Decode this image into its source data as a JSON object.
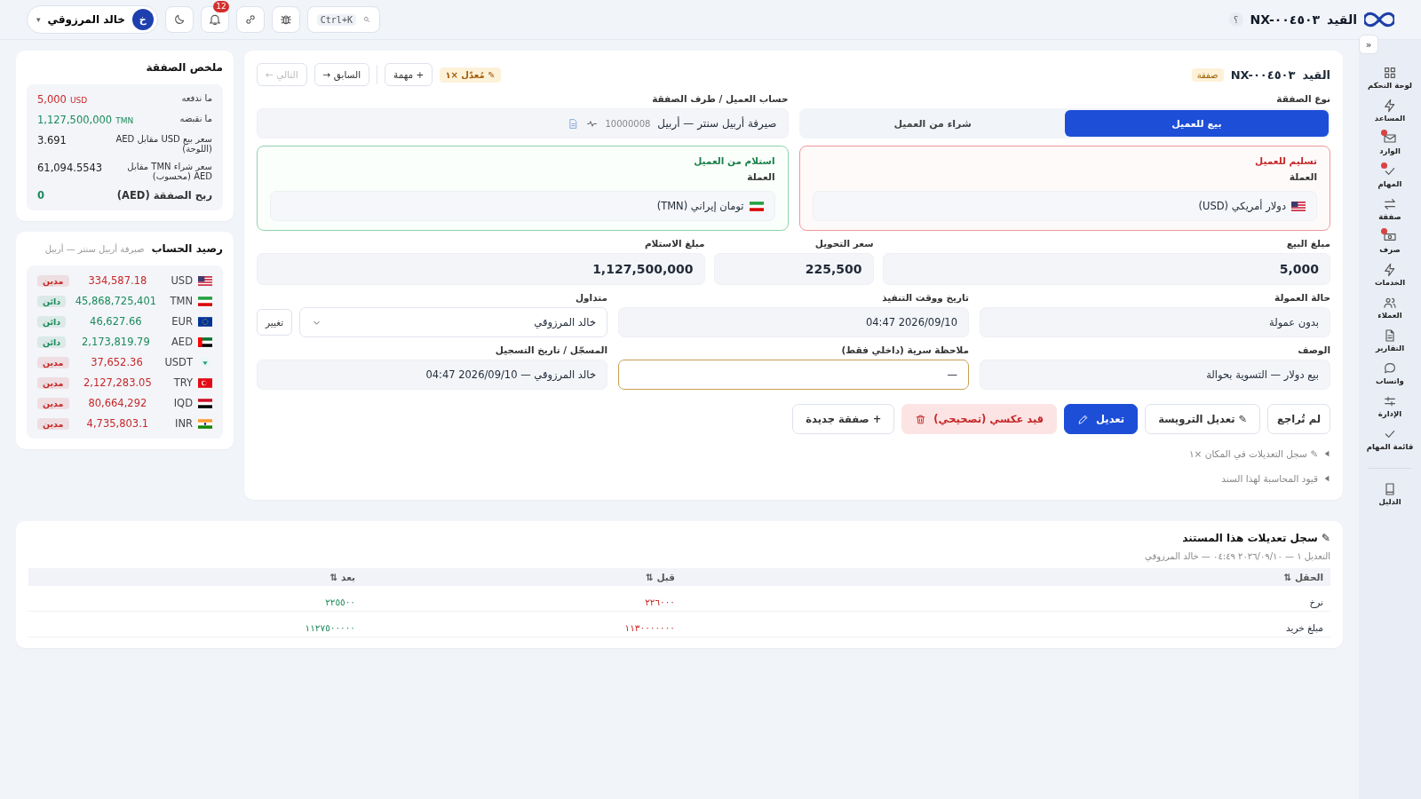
{
  "topbar": {
    "title": "القيد",
    "title_code": "NX-٠٠٤٥٠٣",
    "help": "؟",
    "search_shortcut": "Ctrl+K",
    "notifications": "12",
    "user": {
      "initial": "خ",
      "name": "خالد المرزوقي",
      "caret": "▾"
    }
  },
  "sidebar": {
    "collapse": "«",
    "items": [
      {
        "label": "لوحة التحكم",
        "badge": false
      },
      {
        "label": "المساعد",
        "badge": false
      },
      {
        "label": "الوارد",
        "badge": true
      },
      {
        "label": "المهام",
        "badge": true
      },
      {
        "label": "صفقة",
        "badge": false
      },
      {
        "label": "صرف",
        "badge": true
      },
      {
        "label": "الخدمات",
        "badge": false
      },
      {
        "label": "العملاء",
        "badge": false
      },
      {
        "label": "التقارير",
        "badge": false
      },
      {
        "label": "واتساب",
        "badge": false
      },
      {
        "label": "الإدارة",
        "badge": false
      },
      {
        "label": "قائمة المهام",
        "badge": false
      }
    ],
    "footer_items": [
      {
        "label": "الدليل",
        "badge": false
      }
    ]
  },
  "entry": {
    "title": "القيد",
    "title_code": "NX-٠٠٤٥٠٣",
    "type_badge": "صفقة",
    "edited_badge": "✎ مُعدّل ×١",
    "task_button": "+ مهمة",
    "prev_button": {
      "label": "السابق →",
      "disabled": false
    },
    "next_button": {
      "label": "التالي ←",
      "disabled": true
    },
    "deal_type": {
      "label": "نوع الصفقة",
      "options": [
        {
          "label": "بيع للعميل",
          "selected": true
        },
        {
          "label": "شراء من العميل",
          "selected": false
        }
      ]
    },
    "account": {
      "label": "حساب العميل / طرف الصفقة",
      "name": "صيرفة أربيل سنتر — أربيل",
      "code": "10000008"
    },
    "legs": [
      {
        "kind": "deliver",
        "title": "تسليم للعميل",
        "currency_label": "العملة",
        "currency": "دولار أمريكي (USD)"
      },
      {
        "kind": "receive",
        "title": "استلام من العميل",
        "currency_label": "العملة",
        "currency": "تومان إيراني (TMN)"
      }
    ],
    "amounts": [
      {
        "label": "مبلغ البيع",
        "value": "5,000"
      },
      {
        "label": "سعر التحويل",
        "value": "225,500"
      },
      {
        "label": "مبلغ الاستلام",
        "value": "1,127,500,000"
      }
    ],
    "commission": {
      "label": "حالة العمولة",
      "value": "بدون عمولة"
    },
    "executed_at": {
      "label": "تاريخ ووقت التنفيذ",
      "value": "2026/09/10 04:47"
    },
    "trader": {
      "label": "متداول",
      "value": "خالد المرزوقي",
      "change_button": "تغيير"
    },
    "description": {
      "label": "الوصف",
      "value": "بيع دولار — التسوية بحوالة"
    },
    "secret_note": {
      "label": "ملاحظة سرية (داخلي فقط)",
      "value": "—"
    },
    "registered": {
      "label": "المسجّل / تاريخ التسجيل",
      "value": "خالد المرزوقي — 2026/09/10 04:47"
    },
    "actions": [
      {
        "kind": "status",
        "label": "لم تُراجع"
      },
      {
        "kind": "secondary",
        "label": "✎ تعديل الترويسة"
      },
      {
        "kind": "primary",
        "label": "تعديل"
      },
      {
        "kind": "danger",
        "label": "قيد عكسي (تصحيحي)"
      },
      {
        "kind": "secondary",
        "label": "+ صفقة جديدة"
      }
    ],
    "sections": [
      {
        "label": "✎ سجل التعديلات في المكان ×١",
        "expanded": false
      },
      {
        "label": "قيود المحاسبة لهذا السند",
        "expanded": false
      }
    ]
  },
  "summary": {
    "title": "ملخص الصفقة",
    "rows": [
      {
        "label": "ما ندفعه",
        "value": "5,000",
        "unit": "USD",
        "color": "#c62828"
      },
      {
        "label": "ما نقبضه",
        "value": "1,127,500,000",
        "unit": "TMN",
        "color": "#1b8a5a"
      },
      {
        "label": "سعر بيع USD مقابل AED (اللوحة)",
        "value": "3.691",
        "color": "#222222"
      },
      {
        "label": "سعر شراء TMN مقابل AED (محسوب)",
        "value": "61,094.5543",
        "color": "#222222"
      }
    ],
    "profit": {
      "label": "ربح الصفقة (AED)",
      "value": "0",
      "color": "#1b8a5a"
    }
  },
  "balance": {
    "title": "رصيد الحساب",
    "subtitle": "صيرفة أربيل سنتر — أربيل",
    "rows": [
      {
        "currency": "USD",
        "amount": "334,587.18",
        "color": "#c62828",
        "status": "مدين"
      },
      {
        "currency": "TMN",
        "amount": "45,868,725,401",
        "color": "#1b8a5a",
        "status": "دائن"
      },
      {
        "currency": "EUR",
        "amount": "46,627.66",
        "color": "#1b8a5a",
        "status": "دائن"
      },
      {
        "currency": "AED",
        "amount": "2,173,819.79",
        "color": "#1b8a5a",
        "status": "دائن"
      },
      {
        "currency": "USDT",
        "amount": "37,652.36",
        "color": "#c62828",
        "status": "مدين"
      },
      {
        "currency": "TRY",
        "amount": "2,127,283.05",
        "color": "#c62828",
        "status": "مدين"
      },
      {
        "currency": "IQD",
        "amount": "80,664,292",
        "color": "#c62828",
        "status": "مدين"
      },
      {
        "currency": "INR",
        "amount": "4,735,803.1",
        "color": "#c62828",
        "status": "مدين"
      }
    ]
  },
  "edit_log": {
    "title": "✎ سجل تعديلات هذا المستند",
    "meta": "التعديل ١ — ٢٠٢٦/٠٩/١٠ ٠٤:٤٩ — خالد المرزوقي",
    "columns": [
      "الحقل ⇅",
      "قبل ⇅",
      "بعد ⇅"
    ],
    "rows": [
      [
        "نرخ",
        "٢٢٦٠٠٠",
        "٢٢٥٥٠٠"
      ],
      [
        "مبلغ خريد",
        "١١٣٠٠٠٠٠٠٠",
        "١١٢٧٥٠٠٠٠٠"
      ]
    ]
  }
}
